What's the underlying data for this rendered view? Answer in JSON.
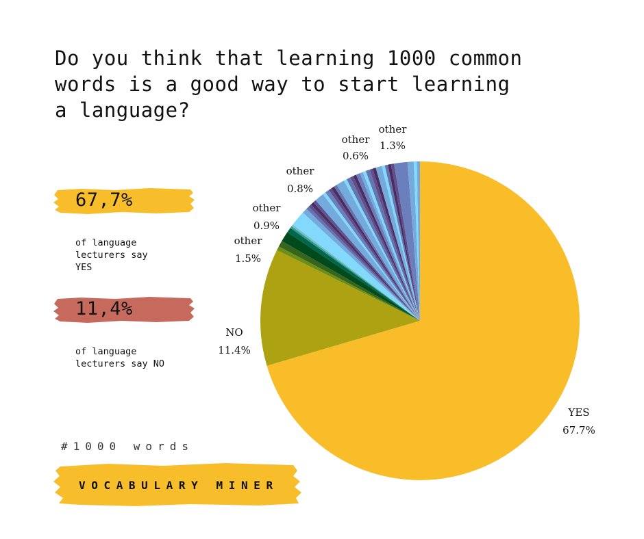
{
  "title": "Do you think that learning 1000 common words is a good way to start learning a language?",
  "title_lines": [
    "Do you think that learning 1000 common",
    "words is a good way to start learning",
    "a language?"
  ],
  "stats": [
    {
      "value": "67,7%",
      "description": "of language\nlecturers say\nYES",
      "highlight_color": "#f7bd2a"
    },
    {
      "value": "11,4%",
      "description": "of language\nlecturers say NO",
      "highlight_color": "#c76a5e"
    }
  ],
  "hashtag": "#1000 words",
  "brand": "VOCABULARY MINER",
  "brand_color": "#f7bd2a",
  "chart_data": {
    "type": "pie",
    "title": "Do you think that learning 1000 common words is a good way to start learning a language?",
    "start_angle": "top",
    "direction": "clockwise",
    "slices": [
      {
        "label": "YES",
        "value": 67.7,
        "color": "#f8bd29",
        "show_label": true
      },
      {
        "label": "NO",
        "value": 11.4,
        "color": "#ada312",
        "show_label": true
      },
      {
        "label": "other",
        "value": 0.4,
        "color": "#6b8f17",
        "show_label": false
      },
      {
        "label": "other",
        "value": 0.6,
        "color": "#38651d",
        "show_label": false
      },
      {
        "label": "other",
        "value": 1.0,
        "color": "#004a1c",
        "show_label": false
      },
      {
        "label": "other",
        "value": 0.5,
        "color": "#00674c",
        "show_label": false
      },
      {
        "label": "other",
        "value": 0.2,
        "color": "#3a9a86",
        "show_label": false
      },
      {
        "label": "other",
        "value": 0.2,
        "color": "#72c3cf",
        "show_label": false
      },
      {
        "label": "other",
        "value": 1.5,
        "color": "#82d9fc",
        "show_label": true
      },
      {
        "label": "other",
        "value": 0.5,
        "color": "#74abdc",
        "show_label": false
      },
      {
        "label": "other",
        "value": 0.3,
        "color": "#6674b0",
        "show_label": false
      },
      {
        "label": "other",
        "value": 0.3,
        "color": "#5e4f8c",
        "show_label": false
      },
      {
        "label": "other",
        "value": 0.3,
        "color": "#4a2c5e",
        "show_label": false
      },
      {
        "label": "other",
        "value": 0.3,
        "color": "#5c5590",
        "show_label": false
      },
      {
        "label": "other",
        "value": 0.9,
        "color": "#74abdc",
        "show_label": true
      },
      {
        "label": "other",
        "value": 0.3,
        "color": "#82d9fc",
        "show_label": false
      },
      {
        "label": "other",
        "value": 0.4,
        "color": "#6b7fbd",
        "show_label": false
      },
      {
        "label": "other",
        "value": 0.3,
        "color": "#5e4f8c",
        "show_label": false
      },
      {
        "label": "other",
        "value": 0.3,
        "color": "#4a2c5e",
        "show_label": false
      },
      {
        "label": "other",
        "value": 0.3,
        "color": "#6674b0",
        "show_label": false
      },
      {
        "label": "other",
        "value": 0.8,
        "color": "#74abdc",
        "show_label": true
      },
      {
        "label": "other",
        "value": 0.3,
        "color": "#82d9fc",
        "show_label": false
      },
      {
        "label": "other",
        "value": 0.4,
        "color": "#6674b0",
        "show_label": false
      },
      {
        "label": "other",
        "value": 0.3,
        "color": "#5e4f8c",
        "show_label": false
      },
      {
        "label": "other",
        "value": 0.3,
        "color": "#4a2c5e",
        "show_label": false
      },
      {
        "label": "other",
        "value": 0.4,
        "color": "#6b7fbd",
        "show_label": false
      },
      {
        "label": "other",
        "value": 0.3,
        "color": "#74abdc",
        "show_label": false
      },
      {
        "label": "other",
        "value": 0.3,
        "color": "#82d9fc",
        "show_label": false
      },
      {
        "label": "other",
        "value": 0.4,
        "color": "#6674b0",
        "show_label": false
      },
      {
        "label": "other",
        "value": 0.3,
        "color": "#5e4f8c",
        "show_label": false
      },
      {
        "label": "other",
        "value": 0.3,
        "color": "#4a2c5e",
        "show_label": false
      },
      {
        "label": "other",
        "value": 0.6,
        "color": "#74abdc",
        "show_label": true
      },
      {
        "label": "other",
        "value": 0.3,
        "color": "#82d9fc",
        "show_label": false
      },
      {
        "label": "other",
        "value": 0.3,
        "color": "#6674b0",
        "show_label": false
      },
      {
        "label": "other",
        "value": 0.3,
        "color": "#4a2c5e",
        "show_label": false
      },
      {
        "label": "other",
        "value": 0.3,
        "color": "#5e4f8c",
        "show_label": false
      },
      {
        "label": "other",
        "value": 1.3,
        "color": "#6b7fbd",
        "show_label": true
      },
      {
        "label": "other",
        "value": 0.6,
        "color": "#74abdc",
        "show_label": false
      },
      {
        "label": "other",
        "value": 0.3,
        "color": "#82d9fc",
        "show_label": false
      },
      {
        "label": "other",
        "value": 0.3,
        "color": "#74abdc",
        "show_label": false
      }
    ],
    "labels": [
      {
        "name": "YES",
        "percent": "67.7%"
      },
      {
        "name": "NO",
        "percent": "11.4%"
      },
      {
        "name": "other",
        "percent": "1.5%"
      },
      {
        "name": "other",
        "percent": "0.9%"
      },
      {
        "name": "other",
        "percent": "0.8%"
      },
      {
        "name": "other",
        "percent": "0.6%"
      },
      {
        "name": "other",
        "percent": "1.3%"
      }
    ],
    "legend": "none"
  }
}
